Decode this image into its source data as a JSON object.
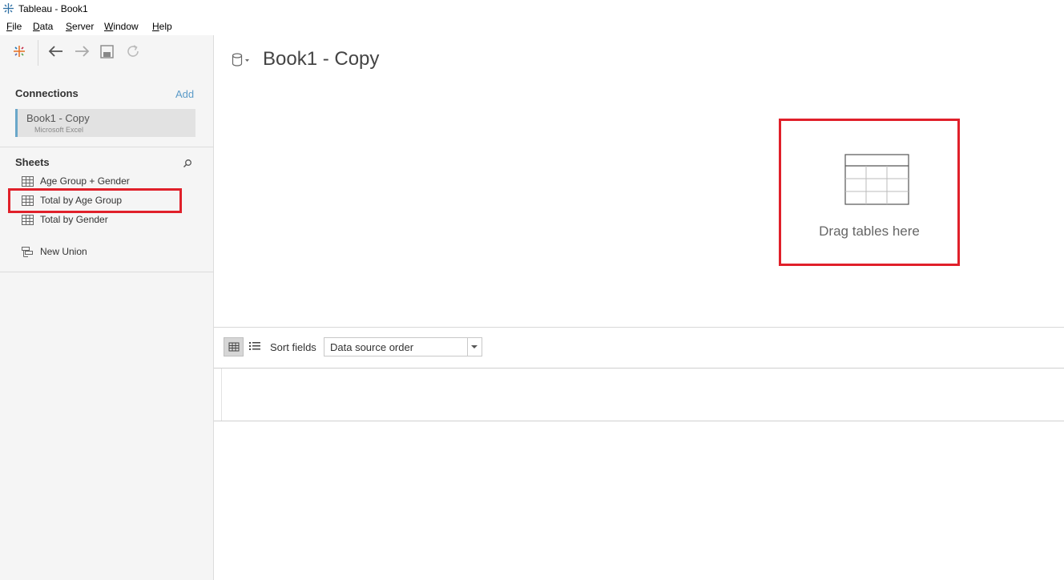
{
  "window": {
    "title": "Tableau - Book1"
  },
  "menu": [
    "File",
    "Data",
    "Server",
    "Window",
    "Help"
  ],
  "toolbar": {
    "icons": [
      "tableau-logo-icon",
      "back-arrow-icon",
      "forward-arrow-icon",
      "save-icon",
      "refresh-icon"
    ]
  },
  "connections": {
    "title": "Connections",
    "add_label": "Add",
    "items": [
      {
        "name": "Book1 - Copy",
        "type": "Microsoft Excel"
      }
    ]
  },
  "sheets": {
    "title": "Sheets",
    "items": [
      {
        "label": "Age Group + Gender"
      },
      {
        "label": "Total by Age Group"
      },
      {
        "label": "Total by Gender"
      }
    ],
    "new_union_label": "New Union"
  },
  "datasource": {
    "title": "Book1 - Copy"
  },
  "canvas": {
    "drop_label": "Drag tables here"
  },
  "grid_toolbar": {
    "sort_label": "Sort fields",
    "sort_value": "Data source order"
  },
  "colors": {
    "highlight": "#e0202a",
    "accent": "#5b9bc8"
  }
}
